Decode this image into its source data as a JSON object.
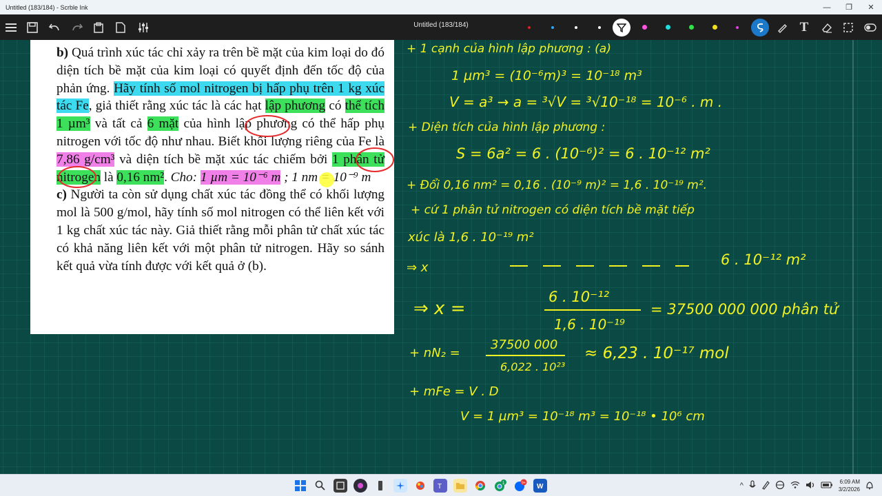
{
  "window": {
    "title": "Untitled (183/184) - Scrble Ink",
    "minimize": "—",
    "restore": "❐",
    "close": "✕"
  },
  "toolbar": {
    "doc_title": "Untitled (183/184)",
    "menu_icon": "menu-icon",
    "save_icon": "save-icon",
    "undo_icon": "undo-icon",
    "redo_icon": "redo-icon",
    "paste_icon": "clipboard-icon",
    "page_icon": "page-icon",
    "settings_icon": "sliders-icon",
    "pen_colors": [
      "#e02020",
      "#2aa6ff",
      "#ffffff",
      "#ffffff",
      "#ff55dd",
      "#22dddd",
      "#33e04a",
      "#f0e020",
      "#e040e0"
    ],
    "text_tool": "T"
  },
  "document": {
    "part_b_label": "b)",
    "part_b_1": "Quá trình xúc tác chỉ xảy ra trên bề mặt của kim loại do đó diện tích bề mặt của kim loại có quyết định đến tốc độ của phản ứng.",
    "part_b_hl1": "Hãy tính số mol nitrogen bị hấp phụ trên 1 kg xúc tác Fe",
    "part_b_2": ", giả thiết rằng xúc tác là các hạt ",
    "part_b_hl2": "lập phương",
    "part_b_3": " có ",
    "part_b_hl3": "thể tích 1 µm³",
    "part_b_4": " và tất cả ",
    "part_b_hl4": "6 mặt",
    "part_b_5": " của hình lập phương có thể hấp phụ nitrogen với tốc độ như nhau. Biết khối lượng riêng của Fe là ",
    "part_b_hl5": "7,86 g/cm³",
    "part_b_6": " và diện tích bề mặt xúc tác chiếm bởi ",
    "part_b_hl6": "1 phân tử nitrogen",
    "part_b_7": " là ",
    "part_b_hl7": "0,16 nm²",
    "part_b_8": ". ",
    "part_b_given": "Cho: ",
    "part_b_hl8": "1 µm = 10⁻⁶ m",
    "part_b_9": " ; 1 nm = 10⁻⁹ m",
    "part_c_label": "c)",
    "part_c": "Người ta còn sử dụng chất xúc tác đồng thể có khối lượng mol là 500 g/mol, hãy tính số mol nitrogen có thể liên kết với 1 kg chất xúc tác này. Giả thiết rằng mỗi phân tử chất xúc tác có khả năng liên kết với một phân tử nitrogen. Hãy so sánh kết quả vừa tính được với kết quả ở (b)."
  },
  "handwriting": {
    "l1": "+ 1 cạnh của hình lập phương : (a)",
    "l2": "1 µm³ = (10⁻⁶m)³ = 10⁻¹⁸ m³",
    "l3": "V = a³ → a = ³√V = ³√10⁻¹⁸ = 10⁻⁶ . m .",
    "l4": "+ Diện tích của hình lập phương :",
    "l5": "S = 6a² = 6 . (10⁻⁶)² = 6 . 10⁻¹² m²",
    "l6": "+ Đổi 0,16 nm² = 0,16 . (10⁻⁹ m)² = 1,6 . 10⁻¹⁹ m².",
    "l7": "+ cứ 1 phân tử nitrogen có diện tích bề mặt tiếp",
    "l8": "xúc là 1,6 . 10⁻¹⁹ m²",
    "l9a": "⇒ x",
    "l9b": "6 . 10⁻¹² m²",
    "l10_lhs": "⇒ x =",
    "l10_num": "6 . 10⁻¹²",
    "l10_den": "1,6 . 10⁻¹⁹",
    "l10_rhs": "= 37500 000 000 phân tử",
    "l11_lhs": "+ nN₂ =",
    "l11_num": "37500 000",
    "l11_den": "6,022 . 10²³",
    "l11_rhs": "≈ 6,23 . 10⁻¹⁷ mol",
    "l12": "+ mFe = V . D",
    "l13": "V = 1 µm³ = 10⁻¹⁸ m³ = 10⁻¹⁸ • 10⁶ cm"
  },
  "taskbar": {
    "start_icon": "windows-start-icon",
    "search_icon": "search-icon",
    "apps": [
      "file-explorer-icon",
      "obs-icon",
      "phone-icon",
      "snipping-icon",
      "paint-icon",
      "teams-icon",
      "folder-icon",
      "chrome-icon",
      "chrome-notif-icon",
      "zalo-icon",
      "word-icon"
    ],
    "tray_badge_1": "1",
    "tray_badge_2": "9+",
    "time": "6:09 AM",
    "date": "3/2/2026",
    "tray_chevron": "^"
  }
}
